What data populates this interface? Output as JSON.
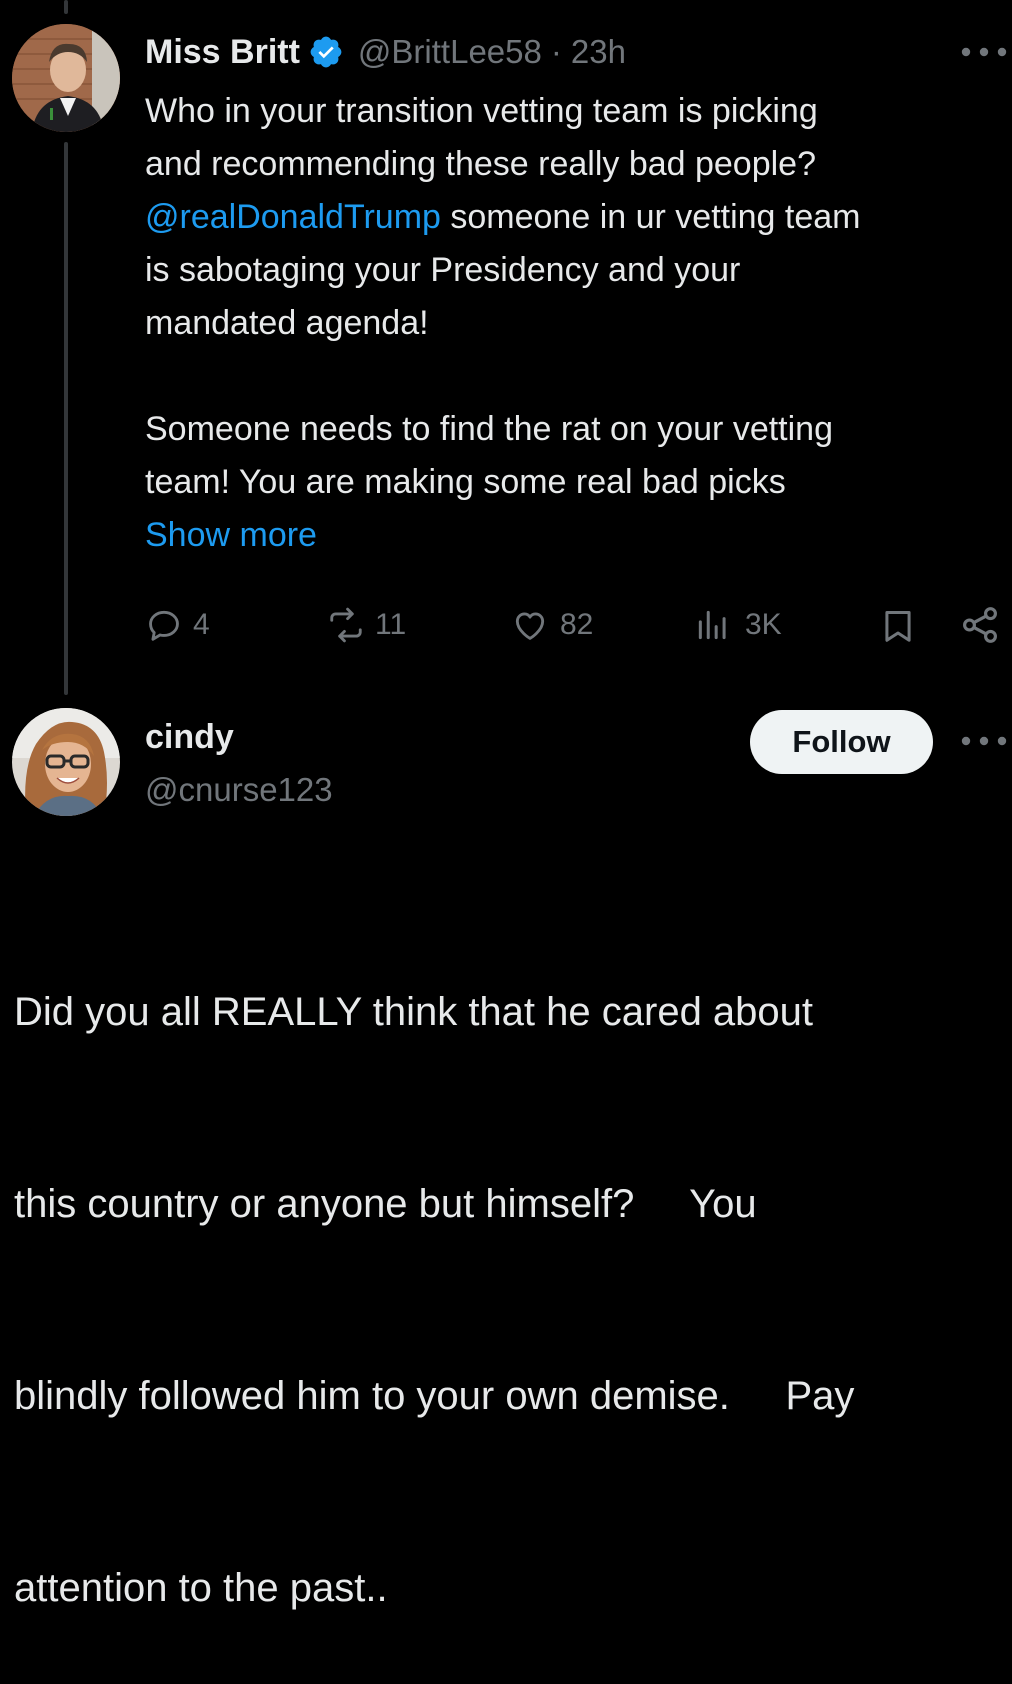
{
  "tweet": {
    "display_name": "Miss Britt",
    "handle": "@BrittLee58",
    "separator": "·",
    "time": "23h",
    "text": {
      "line1": "Who in your transition vetting team is picking",
      "line2": "and recommending these really bad people?",
      "mention": "@realDonaldTrump",
      "line3_rest": " someone in ur vetting team",
      "line4": "is sabotaging your Presidency and your",
      "line5": "mandated agenda!",
      "line6": "Someone needs to find the rat on your vetting",
      "line7": "team! You are making some real bad picks"
    },
    "show_more": "Show more",
    "stats": {
      "replies": "4",
      "reposts": "11",
      "likes": "82",
      "views": "3K"
    },
    "colors": {
      "accent": "#1d9bf0",
      "verified": "#1d9bf0"
    },
    "icons": [
      "verified-badge-icon",
      "more-icon",
      "reply-icon",
      "repost-icon",
      "like-icon",
      "views-icon",
      "bookmark-icon",
      "share-icon"
    ]
  },
  "reply": {
    "display_name": "cindy",
    "handle": "@cnurse123",
    "follow_label": "Follow",
    "text": {
      "line1": "Did you all REALLY think that he cared about",
      "line2": "this country or anyone but himself?     You",
      "line3": "blindly followed him to your own demise.     Pay",
      "line4": "attention to the past.."
    }
  }
}
